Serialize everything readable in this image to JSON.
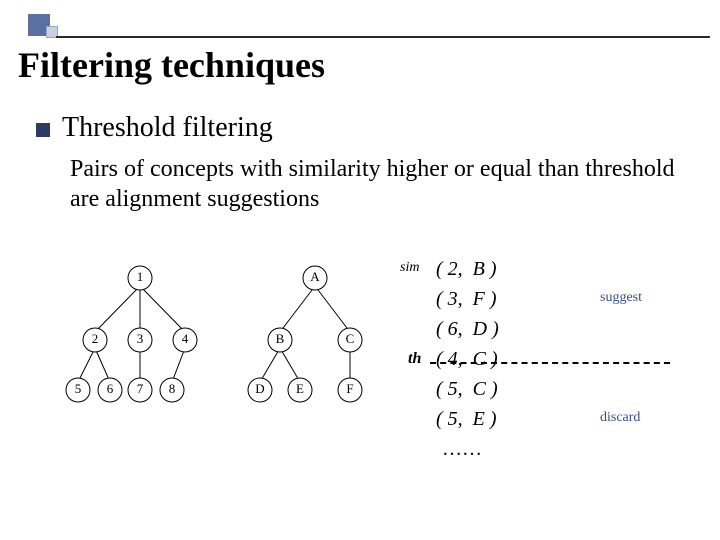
{
  "title": "Filtering techniques",
  "section": {
    "heading": "Threshold filtering",
    "description": "Pairs of concepts with similarity higher or equal than threshold are alignment suggestions"
  },
  "sim_label": "sim",
  "th_label": "th",
  "pairs": [
    {
      "left": "2",
      "right": "B"
    },
    {
      "left": "3",
      "right": "F"
    },
    {
      "left": "6",
      "right": "D"
    },
    {
      "left": "4",
      "right": "C"
    },
    {
      "left": "5",
      "right": "C"
    },
    {
      "left": "5",
      "right": "E"
    }
  ],
  "ellipsis": "……",
  "labels": {
    "suggest": "suggest",
    "discard": "discard"
  },
  "trees": {
    "left": {
      "root": "1",
      "mid": [
        "2",
        "3",
        "4"
      ],
      "leaves": [
        "5",
        "6",
        "7",
        "8"
      ]
    },
    "right": {
      "root": "A",
      "mid": [
        "B",
        "C"
      ],
      "leaves": [
        "D",
        "E",
        "F"
      ]
    }
  },
  "colors": {
    "accent": "#5b6fa3",
    "label": "#3a4f86"
  }
}
